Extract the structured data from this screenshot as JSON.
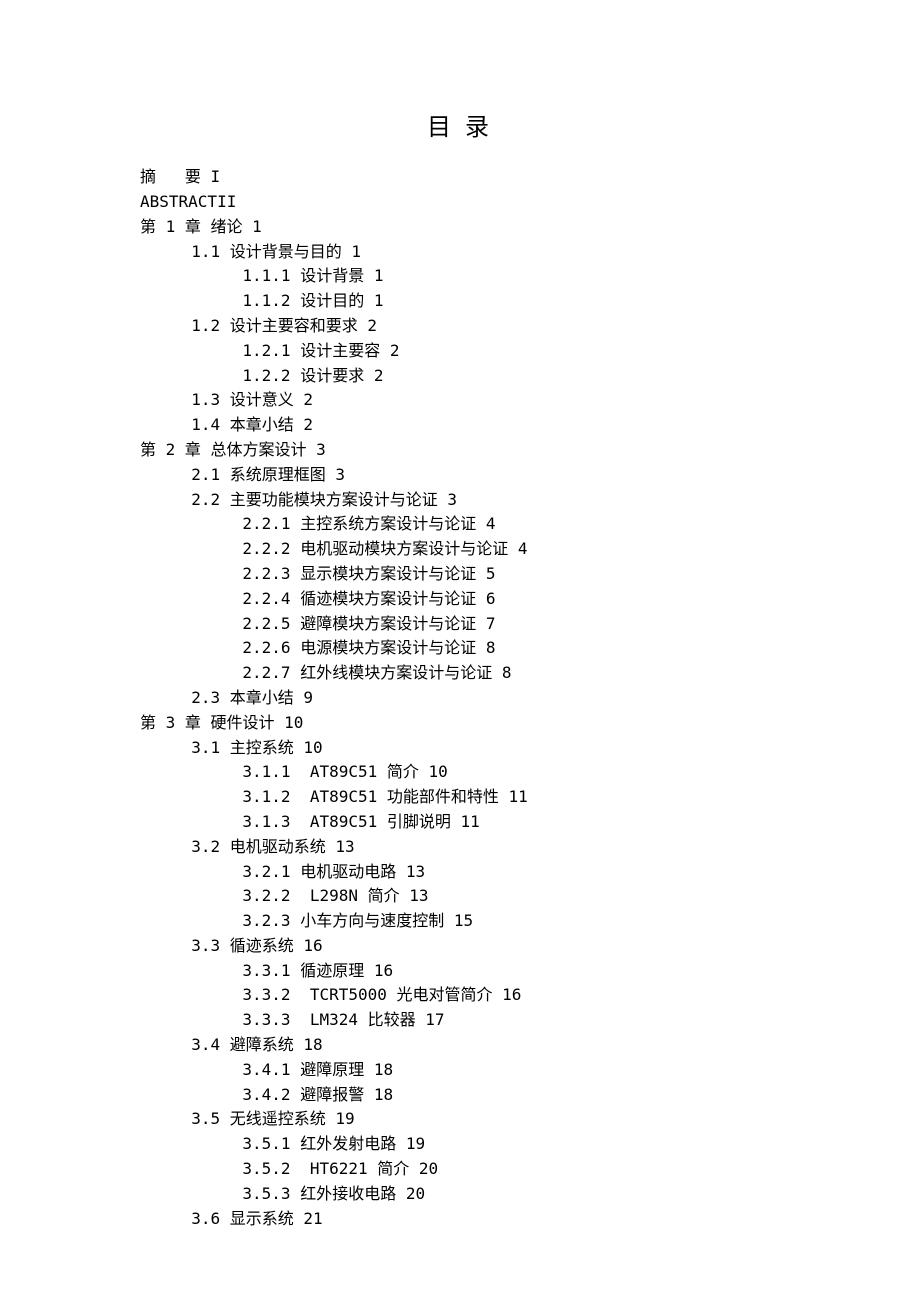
{
  "title": "目 录",
  "toc": [
    {
      "level": 0,
      "text": "摘   要 I"
    },
    {
      "level": 0,
      "text": "ABSTRACTII"
    },
    {
      "level": 0,
      "text": "第 1 章 绪论 1"
    },
    {
      "level": 1,
      "text": "1.1 设计背景与目的 1"
    },
    {
      "level": 2,
      "text": "1.1.1 设计背景 1"
    },
    {
      "level": 2,
      "text": "1.1.2 设计目的 1"
    },
    {
      "level": 1,
      "text": "1.2 设计主要容和要求 2"
    },
    {
      "level": 2,
      "text": "1.2.1 设计主要容 2"
    },
    {
      "level": 2,
      "text": "1.2.2 设计要求 2"
    },
    {
      "level": 1,
      "text": "1.3 设计意义 2"
    },
    {
      "level": 1,
      "text": "1.4 本章小结 2"
    },
    {
      "level": 0,
      "text": "第 2 章 总体方案设计 3"
    },
    {
      "level": 1,
      "text": "2.1 系统原理框图 3"
    },
    {
      "level": 1,
      "text": "2.2 主要功能模块方案设计与论证 3"
    },
    {
      "level": 2,
      "text": "2.2.1 主控系统方案设计与论证 4"
    },
    {
      "level": 2,
      "text": "2.2.2 电机驱动模块方案设计与论证 4"
    },
    {
      "level": 2,
      "text": "2.2.3 显示模块方案设计与论证 5"
    },
    {
      "level": 2,
      "text": "2.2.4 循迹模块方案设计与论证 6"
    },
    {
      "level": 2,
      "text": "2.2.5 避障模块方案设计与论证 7"
    },
    {
      "level": 2,
      "text": "2.2.6 电源模块方案设计与论证 8"
    },
    {
      "level": 2,
      "text": "2.2.7 红外线模块方案设计与论证 8"
    },
    {
      "level": 1,
      "text": "2.3 本章小结 9"
    },
    {
      "level": 0,
      "text": "第 3 章 硬件设计 10"
    },
    {
      "level": 1,
      "text": "3.1 主控系统 10"
    },
    {
      "level": 2,
      "text": "3.1.1  AT89C51 简介 10"
    },
    {
      "level": 2,
      "text": "3.1.2  AT89C51 功能部件和特性 11"
    },
    {
      "level": 2,
      "text": "3.1.3  AT89C51 引脚说明 11"
    },
    {
      "level": 1,
      "text": "3.2 电机驱动系统 13"
    },
    {
      "level": 2,
      "text": "3.2.1 电机驱动电路 13"
    },
    {
      "level": 2,
      "text": "3.2.2  L298N 简介 13"
    },
    {
      "level": 2,
      "text": "3.2.3 小车方向与速度控制 15"
    },
    {
      "level": 1,
      "text": "3.3 循迹系统 16"
    },
    {
      "level": 2,
      "text": "3.3.1 循迹原理 16"
    },
    {
      "level": 2,
      "text": "3.3.2  TCRT5000 光电对管简介 16"
    },
    {
      "level": 2,
      "text": "3.3.3  LM324 比较器 17"
    },
    {
      "level": 1,
      "text": "3.4 避障系统 18"
    },
    {
      "level": 2,
      "text": "3.4.1 避障原理 18"
    },
    {
      "level": 2,
      "text": "3.4.2 避障报警 18"
    },
    {
      "level": 1,
      "text": "3.5 无线遥控系统 19"
    },
    {
      "level": 2,
      "text": "3.5.1 红外发射电路 19"
    },
    {
      "level": 2,
      "text": "3.5.2  HT6221 简介 20"
    },
    {
      "level": 2,
      "text": "3.5.3 红外接收电路 20"
    },
    {
      "level": 1,
      "text": "3.6 显示系统 21"
    }
  ]
}
